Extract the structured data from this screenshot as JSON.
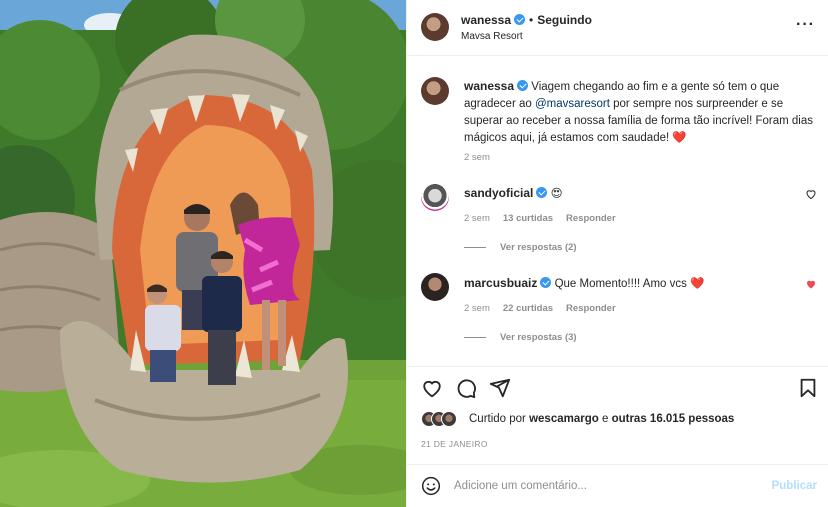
{
  "post": {
    "username": "wanessa",
    "separator": "•",
    "follow_status": "Seguindo",
    "location": "Mavsa Resort",
    "more_icon": "more-options-icon",
    "more_glyph": "···",
    "photo_alt": "Família posando dentro da boca de uma escultura gigante de crocodilo"
  },
  "caption": {
    "username": "wanessa",
    "text_before": "Viagem chegando ao fim e a gente só tem o que agradecer ao ",
    "mention": "@mavsaresort",
    "text_after": " por sempre nos surpreender e se superar ao receber a nossa família de forma tão incrível! Foram dias mágicos aqui, já estamos com saudade! ",
    "emoji": "❤️",
    "time": "2 sem"
  },
  "comments": [
    {
      "username": "sandyoficial",
      "text": "😍",
      "time": "2 sem",
      "likes": "13 curtidas",
      "reply": "Responder",
      "view_replies": "Ver respostas (2)",
      "liked": false
    },
    {
      "username": "marcusbuaiz",
      "text": "Que Momento!!!! Amo vcs ",
      "emoji": "❤️",
      "time": "2 sem",
      "likes": "22 curtidas",
      "reply": "Responder",
      "view_replies": "Ver respostas (3)",
      "liked": true
    }
  ],
  "likes_summary": {
    "prefix": "Curtido por ",
    "user": "wescamargo",
    "middle": " e ",
    "others": "outras 16.015 pessoas"
  },
  "date": "21 DE JANEIRO",
  "add_comment": {
    "placeholder": "Adicione um comentário...",
    "publish": "Publicar"
  },
  "colors": {
    "verified": "#3897f0",
    "heart": "#ed4956",
    "mention": "#00376b",
    "muted": "#8e8e8e",
    "publish_disabled": "#b2dffc"
  }
}
